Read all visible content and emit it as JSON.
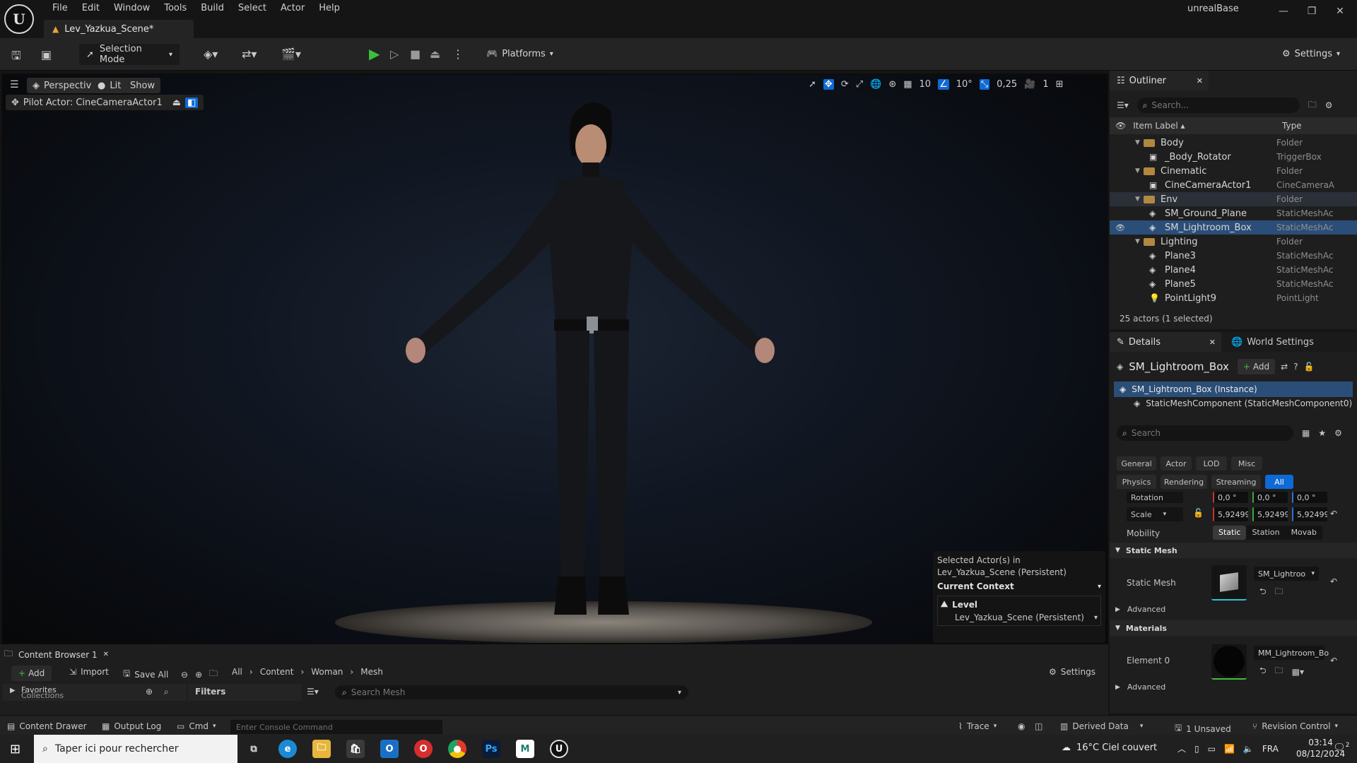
{
  "app": {
    "title": "unrealBase",
    "logo": "U",
    "menu": [
      "File",
      "Edit",
      "Window",
      "Tools",
      "Build",
      "Select",
      "Actor",
      "Help"
    ],
    "document_tab": "Lev_Yazkua_Scene*"
  },
  "toolbar": {
    "selection_mode": "Selection Mode",
    "platforms": "Platforms",
    "settings": "Settings"
  },
  "viewport": {
    "perspective": "Perspective",
    "lit": "Lit",
    "show": "Show",
    "pilot_actor": "Pilot Actor: CineCameraActor1",
    "grid_snap": "10",
    "rotation_snap": "10°",
    "scale_snap": "0,25",
    "camera_speed": "1",
    "context_popup": {
      "selected_line1": "Selected Actor(s) in",
      "selected_line2": "Lev_Yazkua_Scene (Persistent)",
      "current_context": "Current Context",
      "level_label": "Level",
      "level_value": "Lev_Yazkua_Scene (Persistent)"
    }
  },
  "outliner": {
    "tab": "Outliner",
    "search_placeholder": "Search...",
    "col_label": "Item Label ▴",
    "col_type": "Type",
    "rows": [
      {
        "label": "Body",
        "type": "Folder",
        "kind": "folder",
        "indent": 1
      },
      {
        "label": "_Body_Rotator",
        "type": "TriggerBox",
        "kind": "actor",
        "indent": 2
      },
      {
        "label": "Cinematic",
        "type": "Folder",
        "kind": "folder",
        "indent": 1
      },
      {
        "label": "CineCameraActor1",
        "type": "CineCameraA",
        "kind": "actor",
        "indent": 2
      },
      {
        "label": "Env",
        "type": "Folder",
        "kind": "folder",
        "indent": 1
      },
      {
        "label": "SM_Ground_Plane",
        "type": "StaticMeshAc",
        "kind": "mesh",
        "indent": 2
      },
      {
        "label": "SM_Lightroom_Box",
        "type": "StaticMeshAc",
        "kind": "mesh",
        "indent": 2
      },
      {
        "label": "Lighting",
        "type": "Folder",
        "kind": "folder",
        "indent": 1
      },
      {
        "label": "Plane3",
        "type": "StaticMeshAc",
        "kind": "mesh",
        "indent": 2
      },
      {
        "label": "Plane4",
        "type": "StaticMeshAc",
        "kind": "mesh",
        "indent": 2
      },
      {
        "label": "Plane5",
        "type": "StaticMeshAc",
        "kind": "mesh",
        "indent": 2
      },
      {
        "label": "PointLight9",
        "type": "PointLight",
        "kind": "light",
        "indent": 2
      }
    ],
    "footer": "25 actors (1 selected)"
  },
  "details": {
    "tab": "Details",
    "world_settings_tab": "World Settings",
    "actor_name": "SM_Lightroom_Box",
    "add": "Add",
    "instance": "SM_Lightroom_Box (Instance)",
    "component": "StaticMeshComponent (StaticMeshComponent0)",
    "search_placeholder": "Search",
    "categories_row1": [
      "General",
      "Actor",
      "LOD",
      "Misc"
    ],
    "categories_row2": [
      "Physics",
      "Rendering",
      "Streaming",
      "All"
    ],
    "rotation_label": "Rotation",
    "rotation_values": [
      "0,0 °",
      "0,0 °",
      "0,0 °"
    ],
    "scale_label": "Scale",
    "scale_values": [
      "5,92499",
      "5,92499",
      "5,92499"
    ],
    "mobility_label": "Mobility",
    "mobility_options": [
      "Static",
      "Station",
      "Movab"
    ],
    "static_mesh_section": "Static Mesh",
    "static_mesh_label": "Static Mesh",
    "static_mesh_value": "SM_Lightroo",
    "advanced": "Advanced",
    "materials_section": "Materials",
    "element_label": "Element 0",
    "material_value": "MM_Lightroom_Bo",
    "advanced2": "Advanced"
  },
  "content_browser": {
    "tab": "Content Browser 1",
    "add": "Add",
    "import": "Import",
    "save_all": "Save All",
    "breadcrumb": [
      "All",
      "Content",
      "Woman",
      "Mesh"
    ],
    "settings": "Settings",
    "favorites": "Favorites",
    "collections": "Collections",
    "filters": "Filters",
    "search_placeholder": "Search Mesh"
  },
  "statusbar": {
    "content_drawer": "Content Drawer",
    "output_log": "Output Log",
    "cmd": "Cmd",
    "console_placeholder": "Enter Console Command",
    "trace": "Trace",
    "derived_data": "Derived Data",
    "unsaved": "1 Unsaved",
    "revision_control": "Revision Control"
  },
  "taskbar": {
    "search_placeholder": "Taper ici pour rechercher",
    "weather": "16°C  Ciel couvert",
    "lang": "FRA",
    "time": "03:14",
    "date": "08/12/2024",
    "notifications": "2"
  }
}
